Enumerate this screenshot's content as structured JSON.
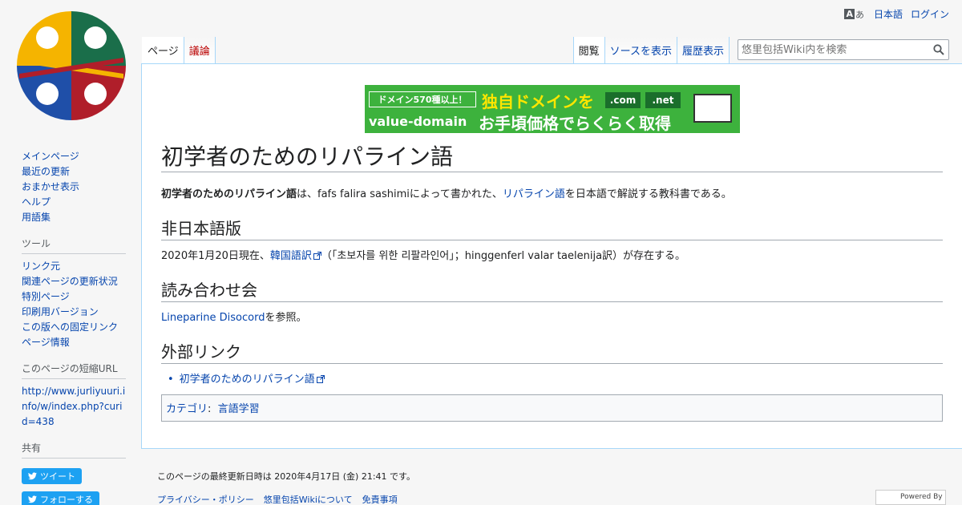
{
  "personal": {
    "language": "日本語",
    "login": "ログイン",
    "uls_glyph_1": "A",
    "uls_glyph_2": "あ"
  },
  "tabs": {
    "left": [
      {
        "label": "ページ",
        "selected": true
      },
      {
        "label": "議論",
        "new": true
      }
    ],
    "right": [
      {
        "label": "閲覧",
        "selected": true
      },
      {
        "label": "ソースを表示"
      },
      {
        "label": "履歴表示"
      }
    ]
  },
  "search": {
    "placeholder": "悠里包括Wiki内を検索"
  },
  "banner": {
    "badge": "ドメイン570種以上！",
    "headline": "独自ドメインを",
    "com": ".com",
    "net": ".net",
    "brand": "value-domain",
    "tagline": "お手頃価格でらくらく取得"
  },
  "article": {
    "title": "初学者のためのリパライン語",
    "intro_bold": "初学者のためのリパライン語",
    "intro_1": "は、fafs falira sashimiによって書かれた、",
    "intro_link": "リパライン語",
    "intro_2": "を日本語で解説する教科書である。",
    "sections": [
      {
        "heading": "非日本語版",
        "text_1": "2020年1月20日現在、",
        "link": "韓国語訳",
        "text_2": "（「초보자를 위한 리팔라인어」；hinggenferl valar taelenija訳）が存在する。"
      },
      {
        "heading": "読み合わせ会",
        "link": "Lineparine Disocord",
        "text_2": "を参照。"
      },
      {
        "heading": "外部リンク",
        "items": [
          "初学者のためのリパライン語"
        ]
      }
    ],
    "categories_label": "カテゴリ",
    "categories_sep": ":",
    "categories": [
      "言語学習"
    ]
  },
  "sidebar": {
    "nav": [
      "メインページ",
      "最近の更新",
      "おまかせ表示",
      "ヘルプ",
      "用語集"
    ],
    "tools_heading": "ツール",
    "tools": [
      "リンク元",
      "関連ページの更新状況",
      "特別ページ",
      "印刷用バージョン",
      "この版への固定リンク",
      "ページ情報"
    ],
    "shorturl_heading": "このページの短縮URL",
    "shorturl": "http://www.jurliyuuri.info/w/index.php?curid=438",
    "share_heading": "共有",
    "tweet": "ツイート",
    "follow": "フォローする"
  },
  "footer": {
    "lastmod": "このページの最終更新日時は 2020年4月17日 (金) 21:41 です。",
    "links": [
      "プライバシー・ポリシー",
      "悠里包括Wikiについて",
      "免責事項"
    ],
    "powered": "Powered By MediaWiki"
  },
  "colors": {
    "link": "#0645ad",
    "new_link": "#ba0000",
    "border": "#a7d7f9",
    "banner_green": "#3db23d",
    "twitter": "#1da1f2"
  }
}
